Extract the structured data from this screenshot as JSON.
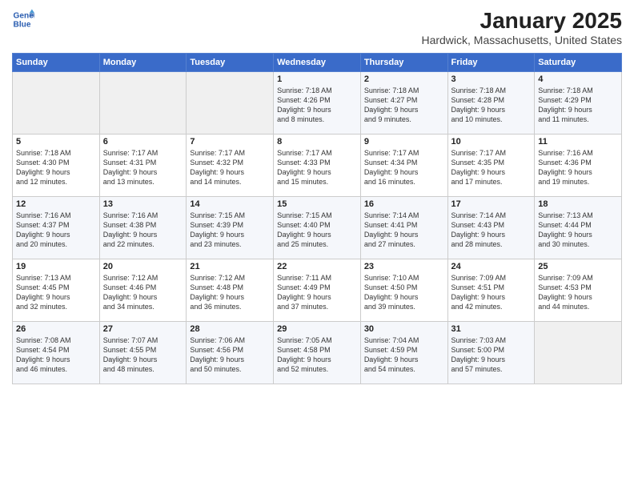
{
  "logo": {
    "line1": "General",
    "line2": "Blue"
  },
  "title": "January 2025",
  "location": "Hardwick, Massachusetts, United States",
  "weekdays": [
    "Sunday",
    "Monday",
    "Tuesday",
    "Wednesday",
    "Thursday",
    "Friday",
    "Saturday"
  ],
  "weeks": [
    [
      {
        "day": "",
        "info": ""
      },
      {
        "day": "",
        "info": ""
      },
      {
        "day": "",
        "info": ""
      },
      {
        "day": "1",
        "info": "Sunrise: 7:18 AM\nSunset: 4:26 PM\nDaylight: 9 hours\nand 8 minutes."
      },
      {
        "day": "2",
        "info": "Sunrise: 7:18 AM\nSunset: 4:27 PM\nDaylight: 9 hours\nand 9 minutes."
      },
      {
        "day": "3",
        "info": "Sunrise: 7:18 AM\nSunset: 4:28 PM\nDaylight: 9 hours\nand 10 minutes."
      },
      {
        "day": "4",
        "info": "Sunrise: 7:18 AM\nSunset: 4:29 PM\nDaylight: 9 hours\nand 11 minutes."
      }
    ],
    [
      {
        "day": "5",
        "info": "Sunrise: 7:18 AM\nSunset: 4:30 PM\nDaylight: 9 hours\nand 12 minutes."
      },
      {
        "day": "6",
        "info": "Sunrise: 7:17 AM\nSunset: 4:31 PM\nDaylight: 9 hours\nand 13 minutes."
      },
      {
        "day": "7",
        "info": "Sunrise: 7:17 AM\nSunset: 4:32 PM\nDaylight: 9 hours\nand 14 minutes."
      },
      {
        "day": "8",
        "info": "Sunrise: 7:17 AM\nSunset: 4:33 PM\nDaylight: 9 hours\nand 15 minutes."
      },
      {
        "day": "9",
        "info": "Sunrise: 7:17 AM\nSunset: 4:34 PM\nDaylight: 9 hours\nand 16 minutes."
      },
      {
        "day": "10",
        "info": "Sunrise: 7:17 AM\nSunset: 4:35 PM\nDaylight: 9 hours\nand 17 minutes."
      },
      {
        "day": "11",
        "info": "Sunrise: 7:16 AM\nSunset: 4:36 PM\nDaylight: 9 hours\nand 19 minutes."
      }
    ],
    [
      {
        "day": "12",
        "info": "Sunrise: 7:16 AM\nSunset: 4:37 PM\nDaylight: 9 hours\nand 20 minutes."
      },
      {
        "day": "13",
        "info": "Sunrise: 7:16 AM\nSunset: 4:38 PM\nDaylight: 9 hours\nand 22 minutes."
      },
      {
        "day": "14",
        "info": "Sunrise: 7:15 AM\nSunset: 4:39 PM\nDaylight: 9 hours\nand 23 minutes."
      },
      {
        "day": "15",
        "info": "Sunrise: 7:15 AM\nSunset: 4:40 PM\nDaylight: 9 hours\nand 25 minutes."
      },
      {
        "day": "16",
        "info": "Sunrise: 7:14 AM\nSunset: 4:41 PM\nDaylight: 9 hours\nand 27 minutes."
      },
      {
        "day": "17",
        "info": "Sunrise: 7:14 AM\nSunset: 4:43 PM\nDaylight: 9 hours\nand 28 minutes."
      },
      {
        "day": "18",
        "info": "Sunrise: 7:13 AM\nSunset: 4:44 PM\nDaylight: 9 hours\nand 30 minutes."
      }
    ],
    [
      {
        "day": "19",
        "info": "Sunrise: 7:13 AM\nSunset: 4:45 PM\nDaylight: 9 hours\nand 32 minutes."
      },
      {
        "day": "20",
        "info": "Sunrise: 7:12 AM\nSunset: 4:46 PM\nDaylight: 9 hours\nand 34 minutes."
      },
      {
        "day": "21",
        "info": "Sunrise: 7:12 AM\nSunset: 4:48 PM\nDaylight: 9 hours\nand 36 minutes."
      },
      {
        "day": "22",
        "info": "Sunrise: 7:11 AM\nSunset: 4:49 PM\nDaylight: 9 hours\nand 37 minutes."
      },
      {
        "day": "23",
        "info": "Sunrise: 7:10 AM\nSunset: 4:50 PM\nDaylight: 9 hours\nand 39 minutes."
      },
      {
        "day": "24",
        "info": "Sunrise: 7:09 AM\nSunset: 4:51 PM\nDaylight: 9 hours\nand 42 minutes."
      },
      {
        "day": "25",
        "info": "Sunrise: 7:09 AM\nSunset: 4:53 PM\nDaylight: 9 hours\nand 44 minutes."
      }
    ],
    [
      {
        "day": "26",
        "info": "Sunrise: 7:08 AM\nSunset: 4:54 PM\nDaylight: 9 hours\nand 46 minutes."
      },
      {
        "day": "27",
        "info": "Sunrise: 7:07 AM\nSunset: 4:55 PM\nDaylight: 9 hours\nand 48 minutes."
      },
      {
        "day": "28",
        "info": "Sunrise: 7:06 AM\nSunset: 4:56 PM\nDaylight: 9 hours\nand 50 minutes."
      },
      {
        "day": "29",
        "info": "Sunrise: 7:05 AM\nSunset: 4:58 PM\nDaylight: 9 hours\nand 52 minutes."
      },
      {
        "day": "30",
        "info": "Sunrise: 7:04 AM\nSunset: 4:59 PM\nDaylight: 9 hours\nand 54 minutes."
      },
      {
        "day": "31",
        "info": "Sunrise: 7:03 AM\nSunset: 5:00 PM\nDaylight: 9 hours\nand 57 minutes."
      },
      {
        "day": "",
        "info": ""
      }
    ]
  ]
}
